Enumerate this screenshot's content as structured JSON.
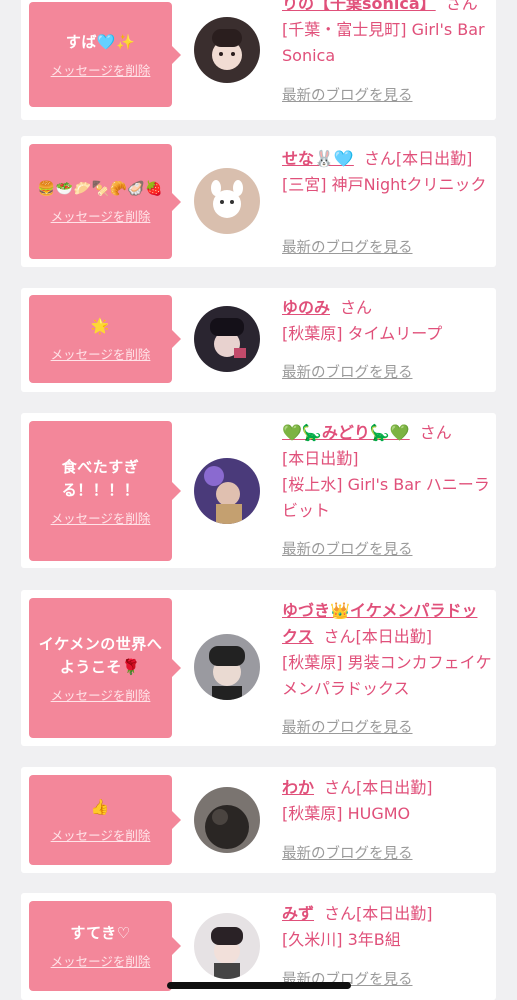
{
  "cards": [
    {
      "message": "すば🩵✨",
      "delete_label": "メッセージを削除",
      "name": "りの【千葉sonica】",
      "suffix": "さん",
      "details": "[千葉・富士見町] Girl's Bar Sonica",
      "blog_label": "最新のブログを見る"
    },
    {
      "message": "🍔🥗🥟🍢🥐🦪🍓",
      "delete_label": "メッセージを削除",
      "name": "せな🐰🩵",
      "suffix": "さん[本日出勤]",
      "details": "[三宮] 神戸Nightクリニック",
      "blog_label": "最新のブログを見る"
    },
    {
      "message": "🌟",
      "delete_label": "メッセージを削除",
      "name": "ゆのみ",
      "suffix": "さん",
      "details": "[秋葉原] タイムリープ",
      "blog_label": "最新のブログを見る"
    },
    {
      "message": "食べたすぎる！！！！",
      "delete_label": "メッセージを削除",
      "name": "💚🦕みどり🦕💚",
      "suffix": "さん",
      "status": "[本日出勤]",
      "details": "[桜上水] Girl's Bar ハニーラビット",
      "blog_label": "最新のブログを見る"
    },
    {
      "message": "イケメンの世界へようこそ🌹",
      "delete_label": "メッセージを削除",
      "name": "ゆづき👑イケメンパラドックス",
      "suffix": "さん[本日出勤]",
      "details": "[秋葉原] 男装コンカフェイケメンパラドックス",
      "blog_label": "最新のブログを見る"
    },
    {
      "message": "👍",
      "delete_label": "メッセージを削除",
      "name": "わか",
      "suffix": "さん[本日出勤]",
      "details": "[秋葉原] HUGMO",
      "blog_label": "最新のブログを見る"
    },
    {
      "message": "すてき♡",
      "delete_label": "メッセージを削除",
      "name": "みず",
      "suffix": "さん[本日出勤]",
      "details": "[久米川] 3年B組",
      "blog_label": "最新のブログを見る"
    }
  ],
  "colors": {
    "bubble": "#f3879a",
    "accent": "#e0507a",
    "muted": "#9a9a9a",
    "background": "#f0f0f2"
  }
}
